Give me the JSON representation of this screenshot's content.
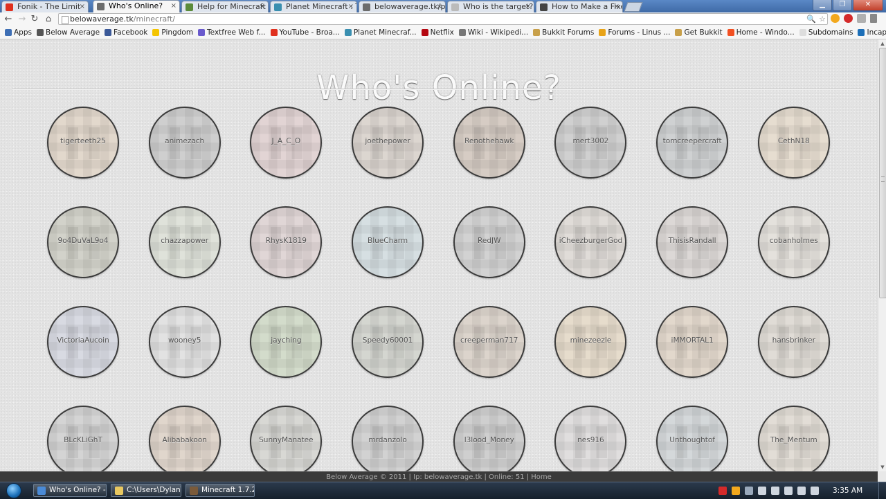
{
  "browser": {
    "tabs": [
      {
        "label": "Fonik - The Limit",
        "icon_color": "#e0301e"
      },
      {
        "label": "Who's Online?",
        "icon_color": "#6c6c6c",
        "active": true
      },
      {
        "label": "Help for Minecraft M",
        "icon_color": "#5b8b3a"
      },
      {
        "label": "Planet Minecraft : Te",
        "icon_color": "#3a8fb0"
      },
      {
        "label": "belowaverage.tk/ph",
        "icon_color": "#6c6c6c"
      },
      {
        "label": "Who is the target?",
        "icon_color": "#bbbbbb"
      },
      {
        "label": "How to Make a Fixe",
        "icon_color": "#444444"
      }
    ],
    "close_glyph": "×",
    "window_controls": {
      "minimize": "▁",
      "maximize": "❐",
      "close": "✕"
    },
    "nav": {
      "back": "←",
      "forward": "→",
      "reload": "↻",
      "home": "⌂"
    },
    "url": {
      "host": "belowaverage.tk",
      "path": "/minecraft/"
    },
    "omnibox_icons": [
      "🔍",
      "☆"
    ]
  },
  "bookmarks": [
    {
      "label": "Apps",
      "icon_color": "#3e6fb5"
    },
    {
      "label": "Below Average",
      "icon_color": "#555555"
    },
    {
      "label": "Facebook",
      "icon_color": "#3b5998"
    },
    {
      "label": "Pingdom",
      "icon_color": "#f4c400"
    },
    {
      "label": "Textfree Web f...",
      "icon_color": "#6a5acd"
    },
    {
      "label": "YouTube - Broa...",
      "icon_color": "#e0301e"
    },
    {
      "label": "Planet Minecraf...",
      "icon_color": "#3a8fb0"
    },
    {
      "label": "Netflix",
      "icon_color": "#b40710"
    },
    {
      "label": "Wiki - Wikipedi...",
      "icon_color": "#777777"
    },
    {
      "label": "Bukkit Forums",
      "icon_color": "#c8a04a"
    },
    {
      "label": "Forums - Linus ...",
      "icon_color": "#e8a317"
    },
    {
      "label": "Get Bukkit",
      "icon_color": "#c8a04a"
    },
    {
      "label": "Home - Windo...",
      "icon_color": "#f25022"
    },
    {
      "label": "Subdomains",
      "icon_color": "#dddddd"
    },
    {
      "label": "Incapsula - Imp...",
      "icon_color": "#1d6fb8"
    }
  ],
  "page": {
    "title": "Who's Online?",
    "players": [
      {
        "name": "tigerteeth25",
        "color": "#e2d8cc"
      },
      {
        "name": "animezach",
        "color": "#cfcfcf"
      },
      {
        "name": "J_A_C_O",
        "color": "#e2d4d4"
      },
      {
        "name": "joethepower",
        "color": "#dcd6d0"
      },
      {
        "name": "Renothehawk",
        "color": "#d6ccc4"
      },
      {
        "name": "mert3002",
        "color": "#d0d0d0"
      },
      {
        "name": "tomcreepercraft",
        "color": "#cfd1d2"
      },
      {
        "name": "CethN18",
        "color": "#e6ddd0"
      },
      {
        "name": "9o4DuVaL9o4",
        "color": "#d2d2ca"
      },
      {
        "name": "chazzapower",
        "color": "#dfe2da"
      },
      {
        "name": "RhysK1819",
        "color": "#e0d6d6"
      },
      {
        "name": "BlueCharm",
        "color": "#d6dfe2"
      },
      {
        "name": "RedJW",
        "color": "#d2d2d2"
      },
      {
        "name": "iCheezburgerGod",
        "color": "#e0dcd8"
      },
      {
        "name": "ThisisRandall",
        "color": "#dcd8d6"
      },
      {
        "name": "cobanholmes",
        "color": "#e4e1dc"
      },
      {
        "name": "VictoriaAucoin",
        "color": "#d8dae2"
      },
      {
        "name": "wooney5",
        "color": "#e2e2e2"
      },
      {
        "name": "jayching",
        "color": "#d3dccb"
      },
      {
        "name": "Speedy60001",
        "color": "#d4d6d0"
      },
      {
        "name": "creeperman717",
        "color": "#dcd4cc"
      },
      {
        "name": "minezeezle",
        "color": "#e6dccc"
      },
      {
        "name": "iMMORTAL1",
        "color": "#e2d8cc"
      },
      {
        "name": "hansbrinker",
        "color": "#e0dcd6"
      },
      {
        "name": "BLcKLiGhT",
        "color": "#d4d4d4"
      },
      {
        "name": "Alibabakoon",
        "color": "#e0d6cc"
      },
      {
        "name": "SunnyManatee",
        "color": "#d8d8d4"
      },
      {
        "name": "mrdanzolo",
        "color": "#d2d2d2"
      },
      {
        "name": "l3lood_Money",
        "color": "#cfcfcf"
      },
      {
        "name": "nes916",
        "color": "#e0dede"
      },
      {
        "name": "Unthoughtof",
        "color": "#d4d8da"
      },
      {
        "name": "The_Mentum",
        "color": "#e2ddd6"
      }
    ],
    "footer": "Below Average © 2011 | Ip: belowaverage.tk | Online: 51 | Home"
  },
  "scrollbar": {
    "up": "▲",
    "down": "▼"
  },
  "taskbar": {
    "items": [
      {
        "label": "Who's Online? -...",
        "icon_color": "#4a8ad6"
      },
      {
        "label": "C:\\Users\\Dylan\\...",
        "icon_color": "#e8c860"
      },
      {
        "label": "Minecraft 1.7.2",
        "icon_color": "#7a5a3a"
      }
    ],
    "tray_icons": [
      {
        "name": "beats-icon",
        "color": "#d42a2a"
      },
      {
        "name": "app-icon",
        "color": "#f2a81d"
      },
      {
        "name": "tools-icon",
        "color": "#9aa9bb"
      },
      {
        "name": "flag-icon",
        "color": "#cfd6df"
      },
      {
        "name": "network-icon",
        "color": "#cfd6df"
      },
      {
        "name": "signal-icon",
        "color": "#cfd6df"
      },
      {
        "name": "power-icon",
        "color": "#cfd6df"
      },
      {
        "name": "volume-icon",
        "color": "#cfd6df"
      }
    ],
    "clock": "3:35 AM"
  }
}
